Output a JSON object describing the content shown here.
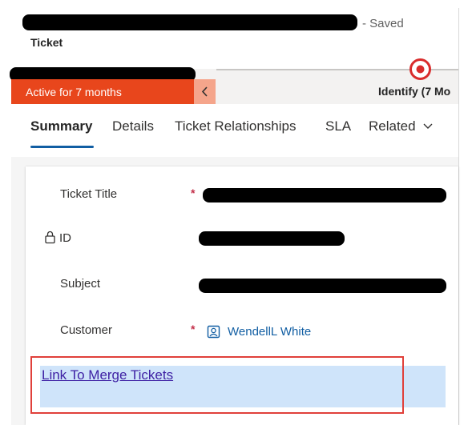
{
  "header": {
    "save_status": "- Saved",
    "entity_name": "Ticket"
  },
  "status_bar": {
    "status_text": "Active for 7 months",
    "collapse_icon": "chevron-left-icon",
    "active_stage": "Identify  (7 Mo",
    "stage_icon": "active-stage-marker-icon"
  },
  "tabs": {
    "items": [
      {
        "label": "Summary",
        "active": true
      },
      {
        "label": "Details",
        "active": false
      },
      {
        "label": "Ticket Relationships",
        "active": false
      },
      {
        "label": "SLA",
        "active": false
      },
      {
        "label": "Related",
        "active": false,
        "icon": "chevron-down-icon"
      }
    ]
  },
  "form": {
    "fields": [
      {
        "label": "Ticket Title",
        "required": true,
        "value_redacted": true
      },
      {
        "label": "ID",
        "locked": true,
        "value_redacted": true
      },
      {
        "label": "Subject",
        "required": false,
        "value_redacted": true
      },
      {
        "label": "Customer",
        "required": true,
        "value": "WendellL White",
        "icon": "contact-icon"
      }
    ],
    "required_marker": "*"
  },
  "merge": {
    "link_text": "Link To Merge Tickets"
  },
  "colors": {
    "status_orange": "#e8461c",
    "stage_red": "#d92c2c",
    "link_blue": "#115ea3",
    "highlight_red": "#e0403a",
    "section_blue": "#cfe4fa"
  }
}
